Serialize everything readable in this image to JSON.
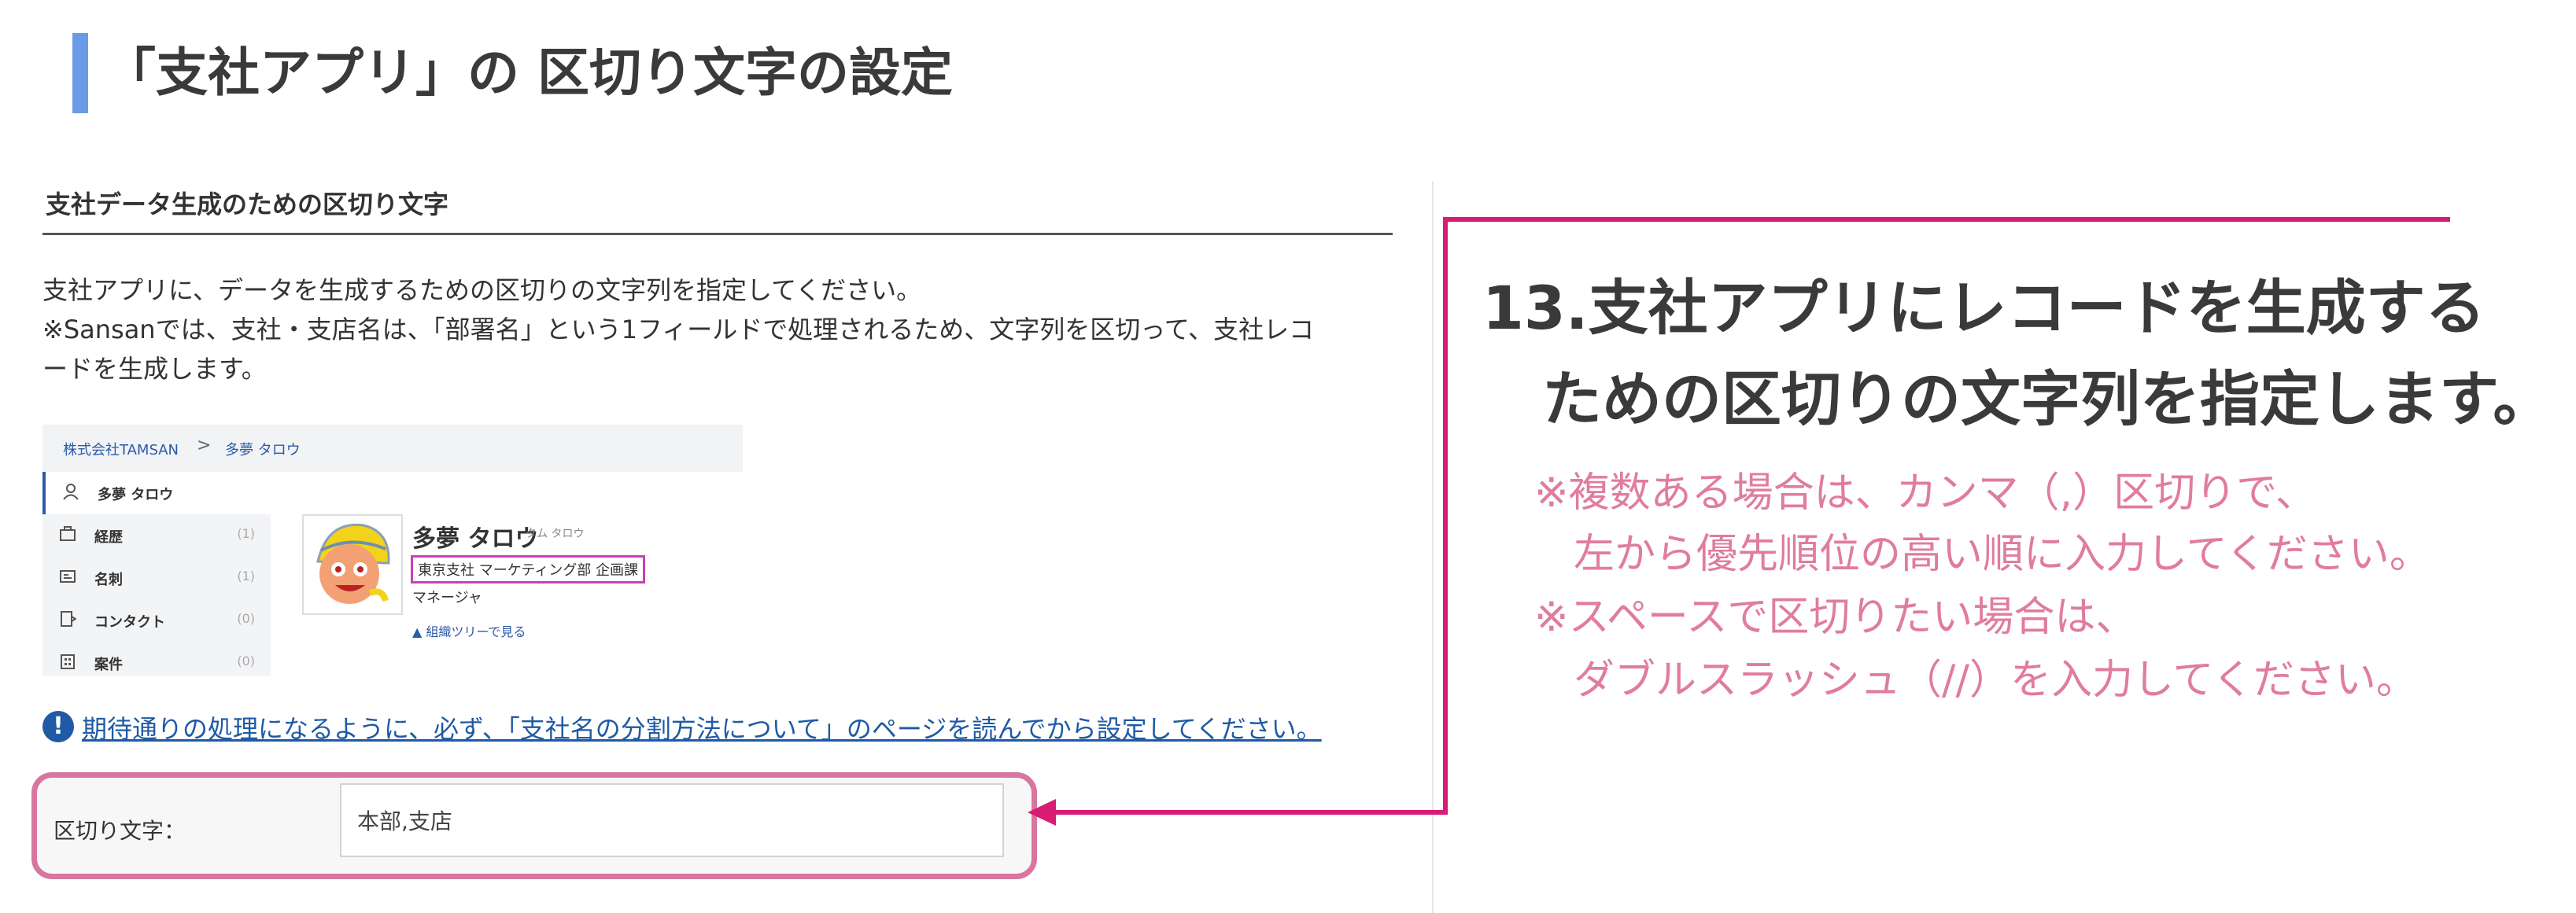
{
  "page_title": "「支社アプリ」の 区切り文字の設定",
  "section": {
    "heading": "支社データ生成のための区切り文字",
    "description_lines": [
      "支社アプリに、データを生成するための区切りの文字列を指定してください。",
      "※Sansanでは、支社・支店名は、「部署名」という1フィールドで処理されるため、文字列を区切って、支社レコ",
      "ードを生成します。"
    ]
  },
  "mini_screenshot": {
    "breadcrumb": [
      "株式会社TAMSAN",
      ">",
      "多夢 タロウ"
    ],
    "sidebar": [
      {
        "icon": "person-icon",
        "label": "多夢 タロウ",
        "count": ""
      },
      {
        "icon": "briefcase-icon",
        "label": "経歴",
        "count": "(1)"
      },
      {
        "icon": "card-icon",
        "label": "名刺",
        "count": "(1)"
      },
      {
        "icon": "contact-icon",
        "label": "コンタクト",
        "count": "(0)"
      },
      {
        "icon": "building-icon",
        "label": "案件",
        "count": "(0)"
      }
    ],
    "person_name": "多夢 タロウ",
    "person_furigana": "タム タロウ",
    "department": "東京支社 マーケティング部 企画課",
    "job_title": "マネージャ",
    "org_tree_link": "組織ツリーで見る"
  },
  "warning": {
    "icon": "exclamation-icon",
    "link_text": "期待通りの処理になるように、必ず、「支社名の分割方法について」のページを読んでから設定してください。"
  },
  "delimiter_field": {
    "label": "区切り文字：",
    "value": "本部,支店"
  },
  "callout": {
    "main_lines": [
      "13.支社アプリにレコードを生成する",
      "ための区切りの文字列を指定します。"
    ],
    "note_lines": [
      "※複数ある場合は、カンマ（,）区切りで、",
      "左から優先順位の高い順に入力してください。",
      "※スペースで区切りたい場合は、",
      "ダブルスラッシュ（//）を入力してください。"
    ]
  },
  "colors": {
    "accent_blue": "#6a9be6",
    "callout_magenta": "#d81b73",
    "note_pink": "#e07c9f",
    "field_border_pink": "#d7769f",
    "link_blue": "#1f5aa6"
  }
}
